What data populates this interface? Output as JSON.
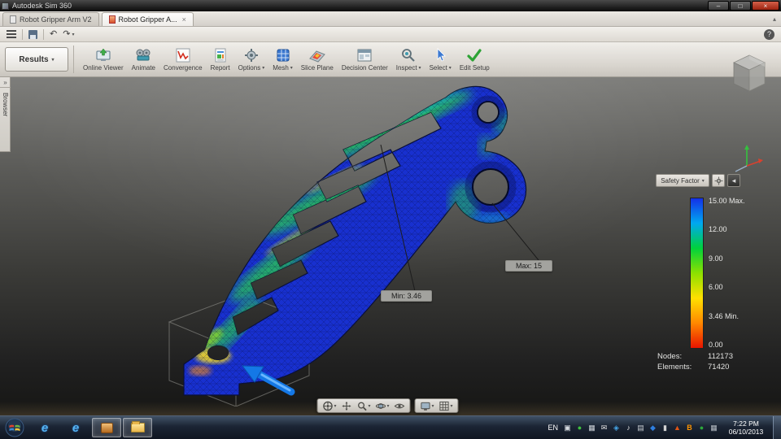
{
  "window": {
    "title": "Autodesk Sim 360"
  },
  "ui": {
    "caret_down": "▾",
    "minimize": "–",
    "maximize": "□",
    "close": "×",
    "tab_close": "×",
    "help": "?",
    "browser_expand": "»",
    "undo": "↶",
    "redo": "↷",
    "legend_collapse": "◂",
    "chevron_up": "▴"
  },
  "tabs": [
    {
      "label": "Robot Gripper Arm V2"
    },
    {
      "label": "Robot Gripper A..."
    }
  ],
  "ribbon": {
    "results_label": "Results",
    "items": [
      {
        "label": "Online Viewer"
      },
      {
        "label": "Animate"
      },
      {
        "label": "Convergence"
      },
      {
        "label": "Report"
      },
      {
        "label": "Options"
      },
      {
        "label": "Mesh"
      },
      {
        "label": "Slice Plane"
      },
      {
        "label": "Decision Center"
      },
      {
        "label": "Inspect"
      },
      {
        "label": "Select"
      },
      {
        "label": "Edit Setup"
      }
    ]
  },
  "browser": {
    "label": "Browser"
  },
  "viewport": {
    "annotations": {
      "min": "Min: 3.46",
      "max": "Max: 15"
    },
    "legend": {
      "title": "Safety Factor",
      "ticks": [
        "15.00 Max.",
        "12.00",
        "9.00",
        "6.00",
        "3.46 Min.",
        "0.00"
      ],
      "colors": [
        "#1430e8",
        "#00a8f0",
        "#00d23c",
        "#8ce000",
        "#ffe000",
        "#ff8800",
        "#e81400"
      ]
    },
    "stats": {
      "nodes_label": "Nodes:",
      "nodes_value": "112173",
      "elements_label": "Elements:",
      "elements_value": "71420"
    }
  },
  "taskbar": {
    "language": "EN",
    "time": "7:22 PM",
    "date": "06/10/2013",
    "tray": [
      "▣",
      "●",
      "▦",
      "✉",
      "◈",
      "♪",
      "▤",
      "◆",
      "▮",
      "▲",
      "B",
      "●",
      "▦"
    ]
  }
}
